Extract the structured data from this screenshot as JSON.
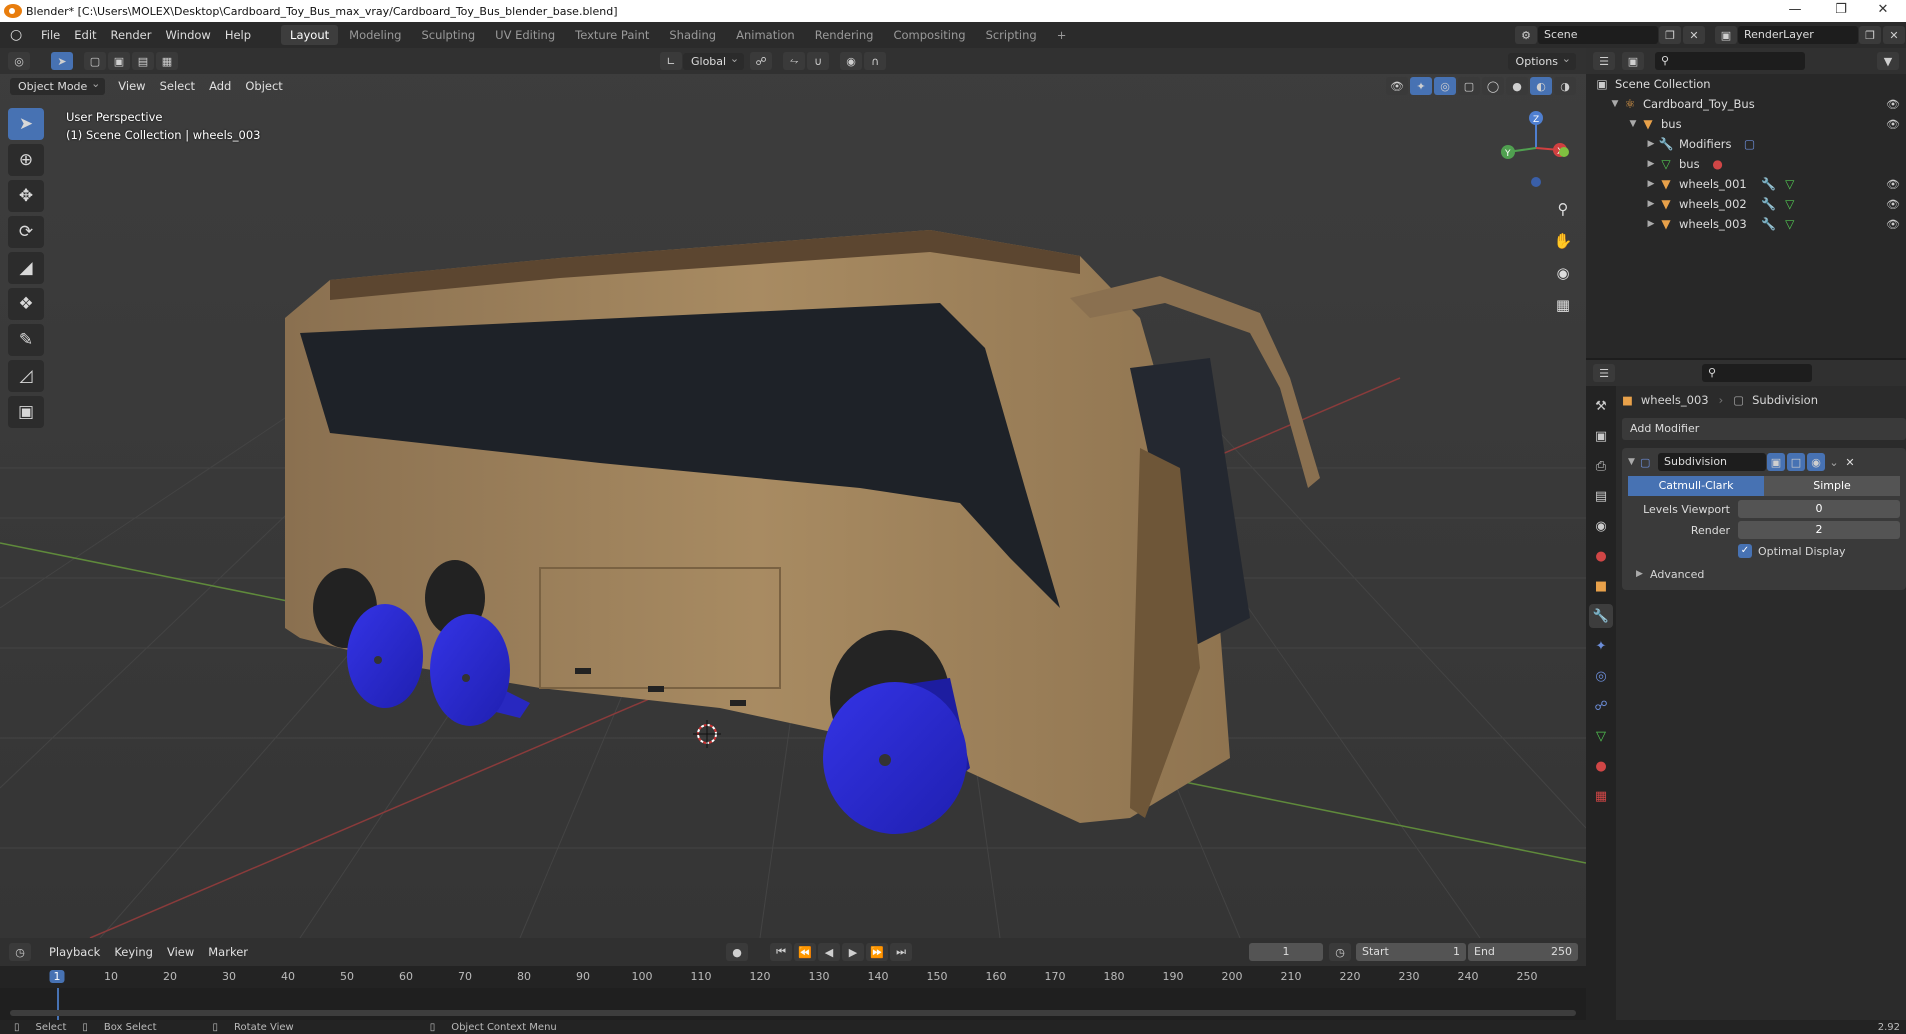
{
  "title": {
    "text": "Blender* [C:\\Users\\MOLEX\\Desktop\\Cardboard_Toy_Bus_max_vray/Cardboard_Toy_Bus_blender_base.blend]"
  },
  "menus": [
    "File",
    "Edit",
    "Render",
    "Window",
    "Help"
  ],
  "workspaces": [
    "Layout",
    "Modeling",
    "Sculpting",
    "UV Editing",
    "Texture Paint",
    "Shading",
    "Animation",
    "Rendering",
    "Compositing",
    "Scripting"
  ],
  "active_workspace": "Layout",
  "scene": {
    "name": "Scene",
    "render_layer": "RenderLayer"
  },
  "viewport": {
    "mode": "Object Mode",
    "menus": [
      "View",
      "Select",
      "Add",
      "Object"
    ],
    "transform": "Global",
    "options": "Options",
    "overlay_line1": "User Perspective",
    "overlay_line2": "(1) Scene Collection | wheels_003",
    "gizmo_axes": {
      "z": "Z",
      "y": "Y",
      "x": "X"
    }
  },
  "outliner": {
    "title": "Scene Collection",
    "rows": [
      {
        "label": "Cardboard_Toy_Bus",
        "indent": 1
      },
      {
        "label": "bus",
        "indent": 2
      },
      {
        "label": "Modifiers",
        "indent": 3
      },
      {
        "label": "bus",
        "indent": 3
      },
      {
        "label": "wheels_001",
        "indent": 3
      },
      {
        "label": "wheels_002",
        "indent": 3
      },
      {
        "label": "wheels_003",
        "indent": 3
      }
    ]
  },
  "properties": {
    "object_name": "wheels_003",
    "modifier_crumb": "Subdivision",
    "add_modifier": "Add Modifier",
    "modifier_name": "Subdivision",
    "type_options": [
      "Catmull-Clark",
      "Simple"
    ],
    "levels_viewport_label": "Levels Viewport",
    "levels_viewport": "0",
    "render_label": "Render",
    "render_levels": "2",
    "optimal_display": "Optimal Display",
    "advanced": "Advanced"
  },
  "timeline": {
    "menus": [
      "Playback",
      "Keying",
      "View",
      "Marker"
    ],
    "current_frame": "1",
    "start_label": "Start",
    "start": "1",
    "end_label": "End",
    "end": "250",
    "ticks": [
      "1",
      "10",
      "20",
      "30",
      "40",
      "50",
      "60",
      "70",
      "80",
      "90",
      "100",
      "110",
      "120",
      "130",
      "140",
      "150",
      "160",
      "170",
      "180",
      "190",
      "200",
      "210",
      "220",
      "230",
      "240",
      "250"
    ]
  },
  "status": {
    "select": "Select",
    "box_select": "Box Select",
    "rotate": "Rotate View",
    "context_menu": "Object Context Menu",
    "version": "2.92"
  },
  "colors": {
    "accent": "#4772b3",
    "bus": "#a8885e",
    "wheel": "#2b2bd8",
    "grid_bg": "#3b3b3b"
  }
}
